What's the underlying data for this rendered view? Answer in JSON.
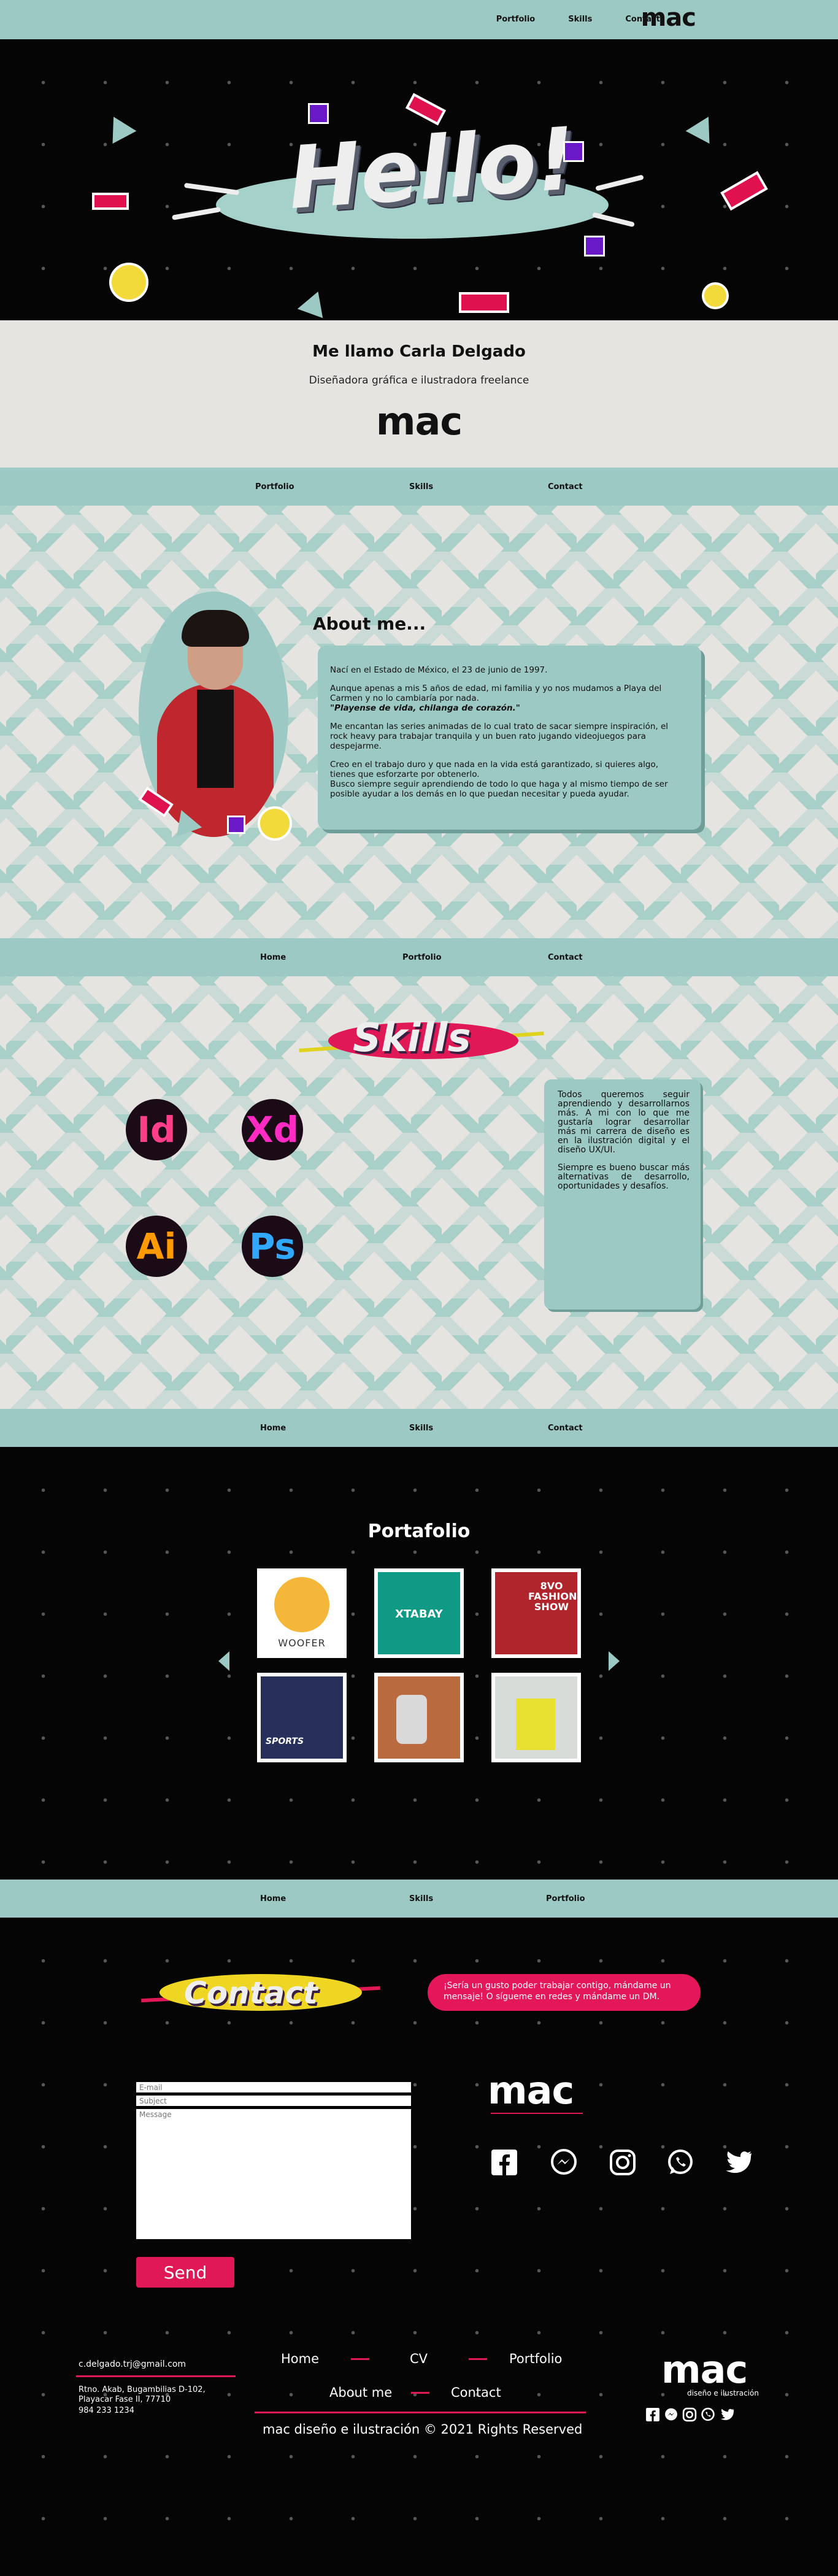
{
  "colors": {
    "teal": "#9cc9c3",
    "pink": "#e01855",
    "yellow": "#f2da3a",
    "purple": "#6a19c9",
    "light": "#e6e4e1",
    "dark": "#050505"
  },
  "top_nav": {
    "items": [
      "Portfolio",
      "Skills",
      "Contact"
    ],
    "logo": "mac"
  },
  "hero": {
    "title": "Hello!"
  },
  "intro": {
    "name": "Me llamo Carla Delgado",
    "role": "Diseñadora gráfica e ilustradora freelance",
    "logo": "mac"
  },
  "nav_about": [
    "Portfolio",
    "Skills",
    "Contact"
  ],
  "about": {
    "title": "About me...",
    "paragraphs": [
      "Nací en el Estado de México, el 23 de junio de 1997.",
      "Aunque apenas a mis 5 años de edad, mi familia y yo nos mudamos a Playa del Carmen y no lo cambiaría por nada.",
      "\"Playense de vida, chilanga de corazón.\"",
      "Me encantan las series animadas de lo cual trato de sacar siempre inspiración, el rock heavy para trabajar tranquila y un buen rato jugando videojuegos para despejarme.",
      "Creo en el trabajo duro y que nada en la vida está garantizado, si quieres algo, tienes que esforzarte por obtenerlo.",
      "Busco siempre seguir aprendiendo de todo lo que haga y al mismo tiempo de ser posible ayudar a los demás en lo que puedan necesitar y pueda ayudar."
    ]
  },
  "nav_skills": [
    "Home",
    "Portfolio",
    "Contact"
  ],
  "skills": {
    "title": "Skills",
    "apps": [
      {
        "label": "Id",
        "icon": "indesign-icon",
        "color": "#ff3e8a"
      },
      {
        "label": "Xd",
        "icon": "xd-icon",
        "color": "#ff2bc2"
      },
      {
        "label": "Ai",
        "icon": "illustrator-icon",
        "color": "#ff9a00"
      },
      {
        "label": "Ps",
        "icon": "photoshop-icon",
        "color": "#31a8ff"
      }
    ],
    "paragraphs": [
      "Todos queremos seguir aprendiendo y desarrollarnos más. A mi con lo que me gustaría lograr desarrollar más mi carrera de diseño es en la ilustración digital y el diseño UX/UI.",
      "Siempre es bueno buscar más alternativas de desarrollo, oportunidades y desafíos."
    ]
  },
  "nav_portfolio": [
    "Home",
    "Skills",
    "Contact"
  ],
  "portfolio": {
    "title": "Portafolio",
    "items": [
      {
        "name": "WOOFER",
        "bg": "#ffffff"
      },
      {
        "name": "XTABAY",
        "bg": "#0f9a86"
      },
      {
        "name": "8VO FASHION SHOW",
        "bg": "#b0252b"
      },
      {
        "name": "SPORTS",
        "bg": "#26305a"
      },
      {
        "name": "",
        "bg": "#b96a3e"
      },
      {
        "name": "",
        "bg": "#d8dcd8"
      }
    ]
  },
  "nav_contact": [
    "Home",
    "Skills",
    "Portfolio"
  ],
  "contact": {
    "title": "Contact",
    "message": "¡Sería un gusto poder trabajar contigo, mándame un mensaje!  O sígueme en redes y mándame un DM.",
    "email_placeholder": "E-mail",
    "subject_placeholder": "Subject",
    "message_placeholder": "Message",
    "send_label": "Send",
    "logo": "mac"
  },
  "footer": {
    "email": "c.delgado.trj@gmail.com",
    "address": [
      "Rtno. Akab, Bugambilias D-102,",
      "Playacar Fase II, 77710"
    ],
    "phone": "984 233 1234",
    "nav_row1": [
      "Home",
      "CV",
      "Portfolio"
    ],
    "nav_row2": [
      "About me",
      "Contact"
    ],
    "copyright": "mac diseño e ilustración © 2021 Rights Reserved",
    "logo": "mac",
    "tagline": "diseño e ilustración"
  }
}
